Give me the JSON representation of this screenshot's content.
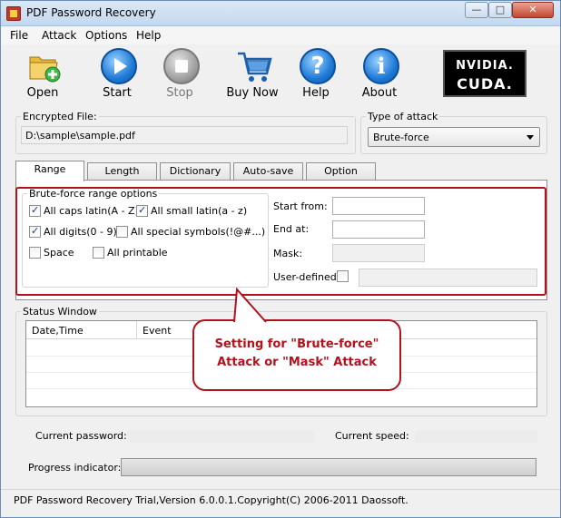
{
  "window": {
    "title": "PDF Password Recovery",
    "controls": {
      "minimize": "—",
      "maximize": "□",
      "close": "✕"
    }
  },
  "menu": [
    "File",
    "Attack",
    "Options",
    "Help"
  ],
  "toolbar": {
    "open": "Open",
    "start": "Start",
    "stop": "Stop",
    "buy_now": "Buy Now",
    "help": "Help",
    "about": "About",
    "badge_line1": "NVIDIA.",
    "badge_line2": "CUDA."
  },
  "encrypted_file": {
    "label": "Encrypted File:",
    "value": "D:\\sample\\sample.pdf"
  },
  "attack_type": {
    "label": "Type of attack",
    "selected": "Brute-force"
  },
  "tabs": [
    "Range",
    "Length",
    "Dictionary",
    "Auto-save",
    "Option"
  ],
  "range": {
    "group_label": "Brute-force range options",
    "options": [
      {
        "label": "All caps latin(A - Z)",
        "checked": true
      },
      {
        "label": "All small latin(a - z)",
        "checked": true
      },
      {
        "label": "All digits(0 - 9)",
        "checked": true
      },
      {
        "label": "All special symbols(!@#...)",
        "checked": false
      },
      {
        "label": "Space",
        "checked": false
      },
      {
        "label": "All printable",
        "checked": false
      }
    ],
    "start_from": {
      "label": "Start from:",
      "value": ""
    },
    "end_at": {
      "label": "End at:",
      "value": ""
    },
    "mask": {
      "label": "Mask:",
      "value": ""
    },
    "user_defined": {
      "label": "User-defined",
      "checked": false,
      "value": ""
    }
  },
  "status_window": {
    "label": "Status Window",
    "columns": [
      "Date,Time",
      "Event"
    ]
  },
  "callout": {
    "line1": "Setting for \"Brute-force\"",
    "line2": "Attack or \"Mask\" Attack"
  },
  "current_password": {
    "label": "Current password:",
    "value": ""
  },
  "current_speed": {
    "label": "Current speed:",
    "value": ""
  },
  "progress": {
    "label": "Progress indicator:",
    "fraction": 0
  },
  "statusbar": "PDF Password Recovery Trial,Version 6.0.0.1.Copyright(C) 2006-2011 Daossoft.",
  "colors": {
    "accent_red": "#b3121c",
    "title_blue": "#c4d8ee"
  }
}
